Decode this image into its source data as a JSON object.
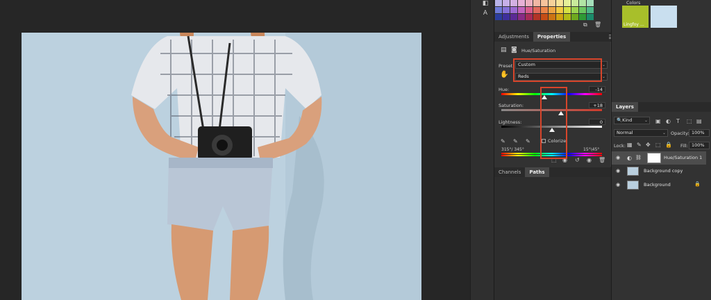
{
  "swatches": {
    "colors": [
      "#b8b3e8",
      "#c7b1e8",
      "#d3b0e3",
      "#e6b0d6",
      "#ecb0bf",
      "#f0b7a4",
      "#f5c39b",
      "#f6d199",
      "#f7e398",
      "#e6ef98",
      "#c9ea9b",
      "#b1e5a4",
      "#a5dfba",
      "#6e7ad8",
      "#8471d8",
      "#9c6ad2",
      "#c163bd",
      "#d85c8c",
      "#e06a5c",
      "#ea8447",
      "#eea542",
      "#f2c941",
      "#d6e044",
      "#9ad24e",
      "#68c560",
      "#4db787",
      "#2b3d9e",
      "#3d2f9c",
      "#5b2a95",
      "#892b86",
      "#a72b58",
      "#b33427",
      "#c54d16",
      "#cc7413",
      "#d2a312",
      "#b2bb16",
      "#6ea91e",
      "#2e9a36",
      "#1c8c6b"
    ]
  },
  "colors_panel": {
    "title": "Colors",
    "swatch_name": "Lingfoy …",
    "swatch1_color": "#a8bf2a",
    "swatch2_color": "#c9dfef"
  },
  "properties_panel": {
    "tabs": [
      "Adjustments",
      "Properties"
    ],
    "adjustment_name": "Hue/Saturation",
    "preset_label": "Preset:",
    "preset_value": "Custom",
    "channel_value": "Reds",
    "hue_label": "Hue:",
    "hue_value": "-14",
    "saturation_label": "Saturation:",
    "saturation_value": "+18",
    "lightness_label": "Lightness:",
    "lightness_value": "0",
    "colorize_label": "Colorize",
    "range_left": "315°/ 345°",
    "range_right": "15°\\45°",
    "hue_level": 0.43,
    "saturation_level": 0.59,
    "lightness_level": 0.5
  },
  "bottom_tabs": [
    "Channels",
    "Paths"
  ],
  "layers_panel": {
    "title": "Layers",
    "kind_label": "Kind",
    "blend_mode": "Normal",
    "opacity_label": "Opacity:",
    "opacity_value": "100%",
    "lock_label": "Lock:",
    "fill_label": "Fill:",
    "fill_value": "100%",
    "layers": [
      {
        "name": "Hue/Saturation 1"
      },
      {
        "name": "Background copy"
      },
      {
        "name": "Background"
      }
    ]
  },
  "accent_red": "#d8452b"
}
